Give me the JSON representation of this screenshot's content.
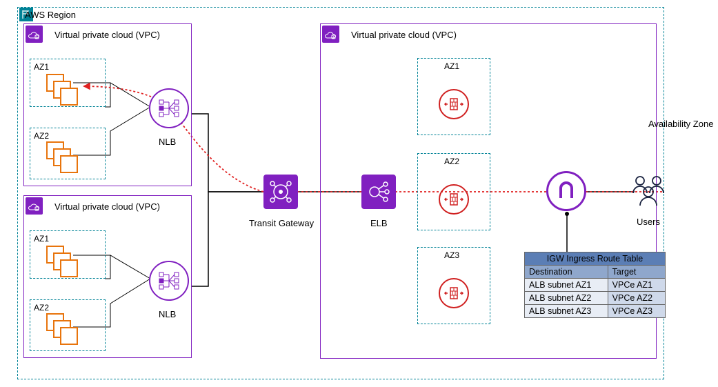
{
  "region": {
    "label": "AWS Region"
  },
  "avz_label": "Availability Zone",
  "vpc_label": "Virtual private cloud (VPC)",
  "nlb_label": "NLB",
  "tgw_label": "Transit Gateway",
  "elb_label": "ELB",
  "users_label": "Users",
  "az": {
    "az1": "AZ1",
    "az2": "AZ2",
    "az3": "AZ3"
  },
  "route_table": {
    "title": "IGW Ingress Route Table",
    "headers": [
      "Destination",
      "Target"
    ],
    "rows": [
      [
        "ALB subnet AZ1",
        "VPCe AZ1"
      ],
      [
        "ALB subnet AZ2",
        "VPCe AZ2"
      ],
      [
        "ALB subnet AZ3",
        "VPCe AZ3"
      ]
    ]
  }
}
